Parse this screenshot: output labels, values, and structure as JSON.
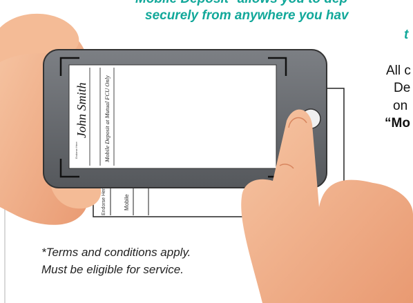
{
  "headline": {
    "line1": "Mobile Deposit* allows you to dep",
    "line2": "securely from anywhere you hav",
    "line3": "t"
  },
  "sidebar_text": {
    "line1": "All c",
    "line2": "De",
    "line3": "on",
    "line4": "“Mo"
  },
  "check": {
    "signature": "John Smith",
    "endorsement": "Mobile Deposit at Mutual FCU Only",
    "endorse_label": "Endorse Here",
    "back_label1": "Endorse Her",
    "back_label2": "Mobile"
  },
  "terms": {
    "line1": "*Terms and conditions apply.",
    "line2": "Must be eligible for service."
  },
  "colors": {
    "headline": "#12a89a",
    "phone_body": "#6b6e72",
    "skin": "#f3b48d"
  }
}
